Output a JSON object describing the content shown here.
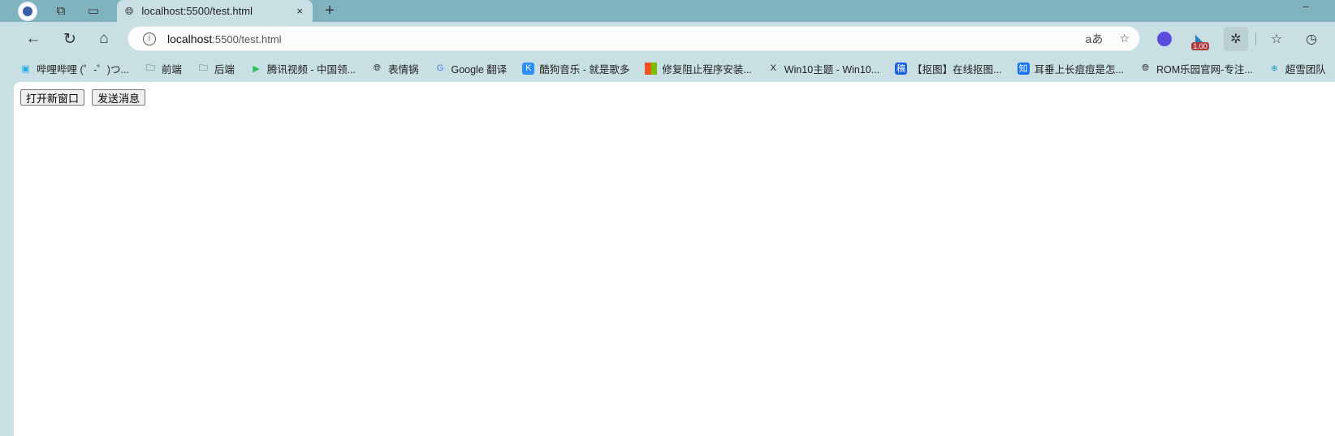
{
  "tab": {
    "title": "localhost:5500/test.html",
    "close": "×"
  },
  "new_tab": "+",
  "address": {
    "host": "localhost",
    "path": ":5500/test.html",
    "read_aloud": "aあ"
  },
  "extension_badge": "1.00",
  "bookmarks": [
    {
      "label": "哔哩哔哩 (゜-゜)つ...",
      "icon": "bilibili-icon",
      "color": "#23ade5"
    },
    {
      "label": "前端",
      "icon": "folder-icon"
    },
    {
      "label": "后端",
      "icon": "folder-icon"
    },
    {
      "label": "腾讯视频 - 中国领...",
      "icon": "tencent-video-icon",
      "color": "#27c25f"
    },
    {
      "label": "表情锅",
      "icon": "globe-icon"
    },
    {
      "label": "Google 翻译",
      "icon": "google-translate-icon",
      "color": "#4285f4"
    },
    {
      "label": "酷狗音乐 - 就是歌多",
      "icon": "kugou-icon",
      "color": "#2c8ef8"
    },
    {
      "label": "修复阻止程序安装...",
      "icon": "microsoft-icon"
    },
    {
      "label": "Win10主题 - Win10...",
      "icon": "x-icon"
    },
    {
      "label": "【抠图】在线抠图...",
      "icon": "gao-icon",
      "color": "#1a5fe0"
    },
    {
      "label": "耳垂上长痘痘是怎...",
      "icon": "zhihu-icon",
      "color": "#1772f6"
    },
    {
      "label": "ROM乐园官网-专注...",
      "icon": "globe-icon"
    },
    {
      "label": "超雪团队",
      "icon": "snowflake-icon",
      "color": "#2aa3b8"
    }
  ],
  "page": {
    "open_window": "打开新窗口",
    "send_message": "发送消息"
  }
}
